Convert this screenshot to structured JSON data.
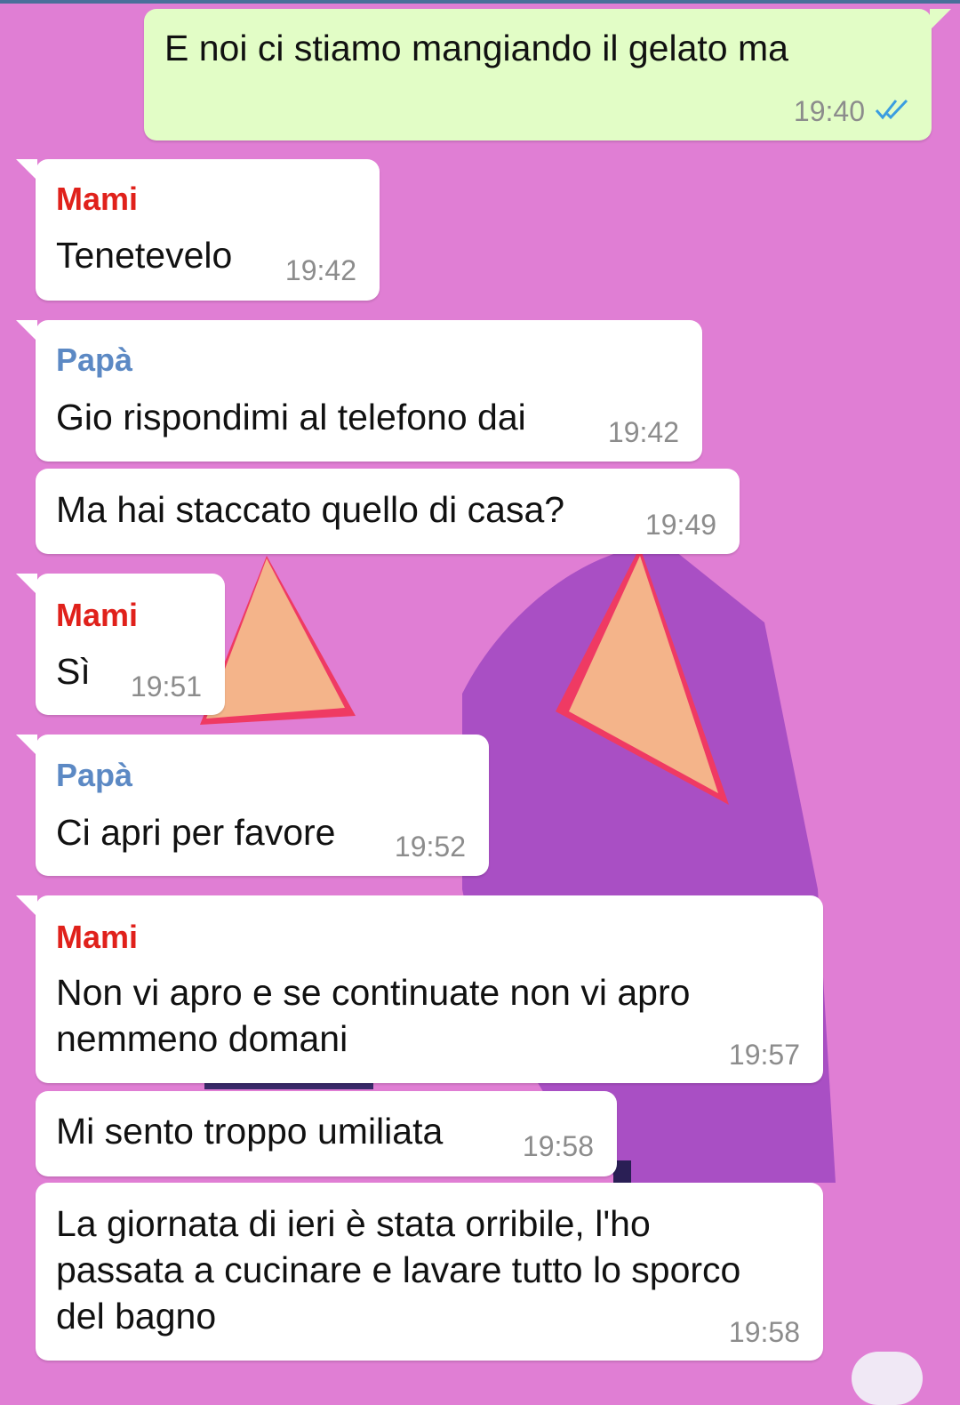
{
  "colors": {
    "background": "#e07ed4",
    "incoming_bubble": "#ffffff",
    "outgoing_bubble": "#e2fdc6",
    "sender_mami": "#e0211b",
    "sender_papa": "#5c89c4",
    "read_ticks": "#3a9de0"
  },
  "messages": [
    {
      "direction": "outgoing",
      "text": "E noi ci stiamo mangiando il gelato ma",
      "time": "19:40",
      "status_icon": "double-check-read-icon"
    },
    {
      "direction": "incoming",
      "sender": "Mami",
      "text": "Tenetevelo",
      "time": "19:42"
    },
    {
      "direction": "incoming",
      "sender": "Papà",
      "text": "Gio rispondimi al telefono dai",
      "time": "19:42"
    },
    {
      "direction": "incoming",
      "text": "Ma hai staccato quello di casa?",
      "time": "19:49"
    },
    {
      "direction": "incoming",
      "sender": "Mami",
      "text": "Sì",
      "time": "19:51"
    },
    {
      "direction": "incoming",
      "sender": "Papà",
      "text": "Ci apri per favore",
      "time": "19:52"
    },
    {
      "direction": "incoming",
      "sender": "Mami",
      "text": "Non vi apro e se continuate non vi apro\nnemmeno domani",
      "time": "19:57"
    },
    {
      "direction": "incoming",
      "text": "Mi sento troppo umiliata",
      "time": "19:58"
    },
    {
      "direction": "incoming",
      "text": "La giornata di ieri è stata orribile, l'ho\npassata a cucinare e lavare tutto lo sporco\ndel bagno",
      "time": "19:58"
    }
  ]
}
